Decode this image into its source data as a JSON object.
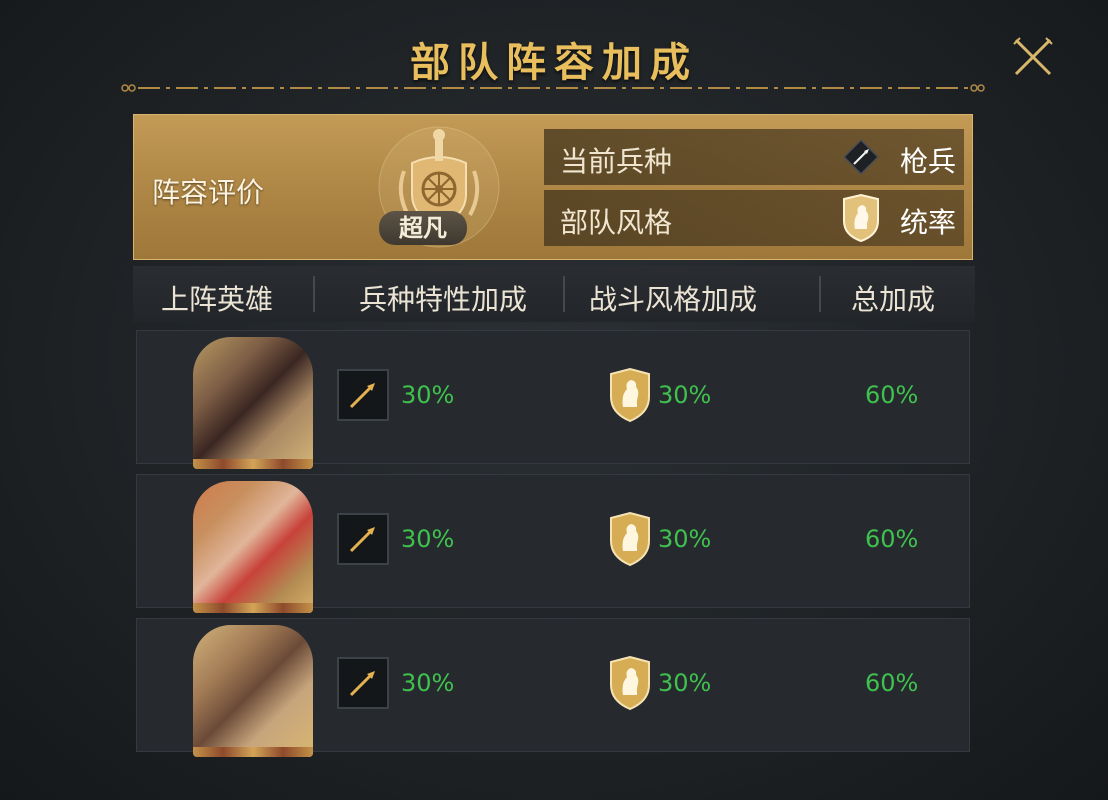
{
  "title": "部队阵容加成",
  "evaluation": {
    "label": "阵容评价",
    "rating": "超凡",
    "current_troop_label": "当前兵种",
    "current_troop_value": "枪兵",
    "troop_style_label": "部队风格",
    "troop_style_value": "统率"
  },
  "table": {
    "headers": [
      "上阵英雄",
      "兵种特性加成",
      "战斗风格加成",
      "总加成"
    ],
    "rows": [
      {
        "troop_bonus": "30%",
        "style_bonus": "30%",
        "total_bonus": "60%"
      },
      {
        "troop_bonus": "30%",
        "style_bonus": "30%",
        "total_bonus": "60%"
      },
      {
        "troop_bonus": "30%",
        "style_bonus": "30%",
        "total_bonus": "60%"
      }
    ]
  },
  "icons": {
    "close": "close-icon",
    "emblem": "crest-emblem-icon",
    "troop": "spear-icon",
    "style": "lion-shield-icon"
  },
  "colors": {
    "title_gold": "#e9bf5e",
    "panel_gold": "#b8914d",
    "bonus_green": "#3fc14d",
    "background": "#1f2326"
  }
}
